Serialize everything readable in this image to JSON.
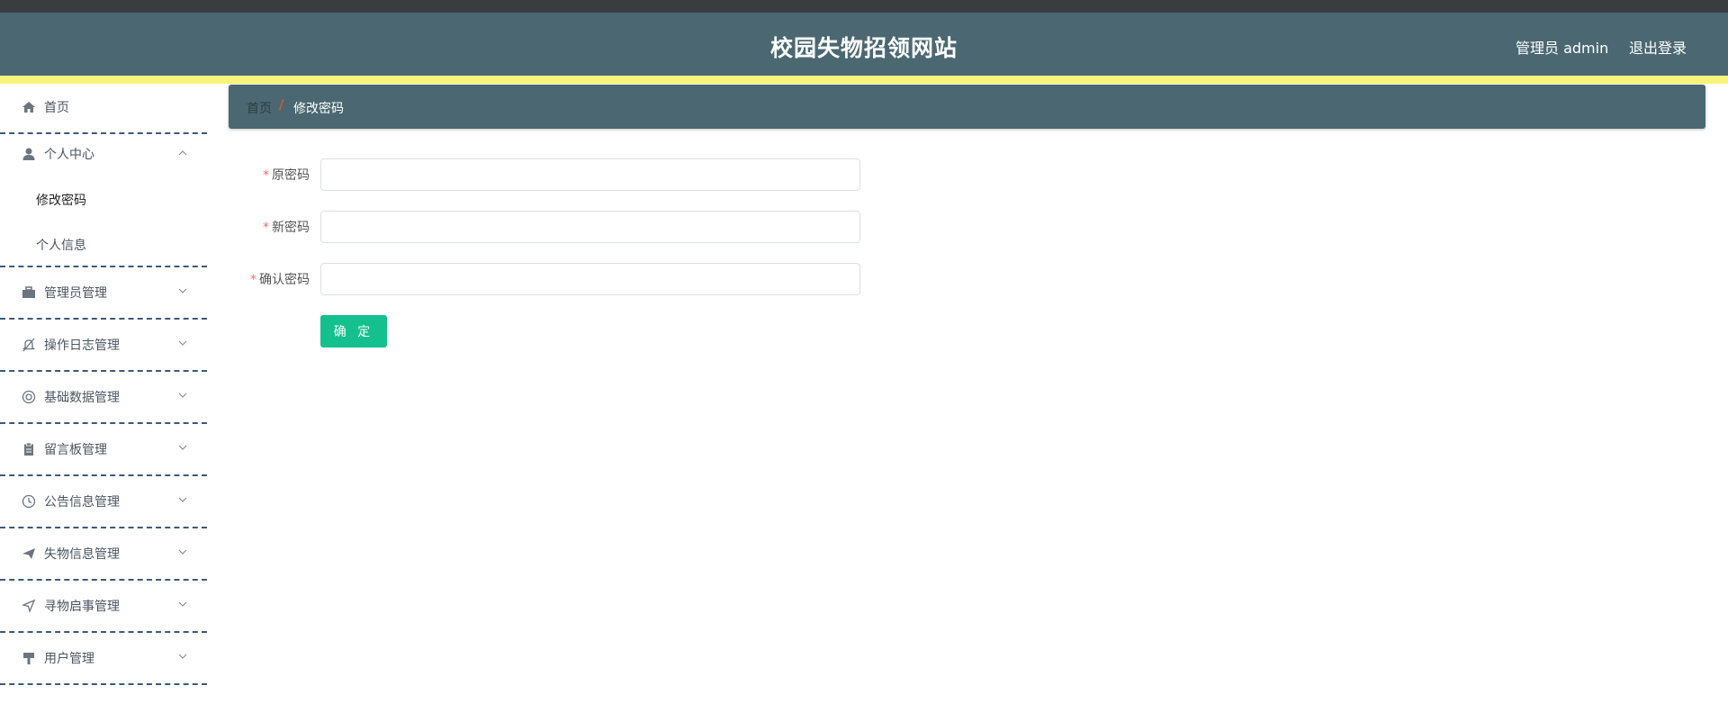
{
  "header": {
    "title": "校园失物招领网站",
    "user": "管理员 admin",
    "logout": "退出登录"
  },
  "sidebar": {
    "home": "首页",
    "personal_center": {
      "label": "个人中心",
      "sub_items": [
        "修改密码",
        "个人信息"
      ]
    },
    "items": [
      "管理员管理",
      "操作日志管理",
      "基础数据管理",
      "留言板管理",
      "公告信息管理",
      "失物信息管理",
      "寻物启事管理",
      "用户管理"
    ]
  },
  "breadcrumb": {
    "home": "首页",
    "separator": "/",
    "current": "修改密码"
  },
  "form": {
    "required_mark": "*",
    "old_password_label": "原密码",
    "old_password_value": "",
    "new_password_label": "新密码",
    "new_password_value": "",
    "confirm_password_label": "确认密码",
    "confirm_password_value": "",
    "submit": "确 定"
  },
  "colors": {
    "header_bg": "#4b6872",
    "accent_yellow": "#f7f47b",
    "button_green": "#14c08e",
    "required_red": "#f56c6c",
    "divider_blue": "#3d5a7a"
  }
}
